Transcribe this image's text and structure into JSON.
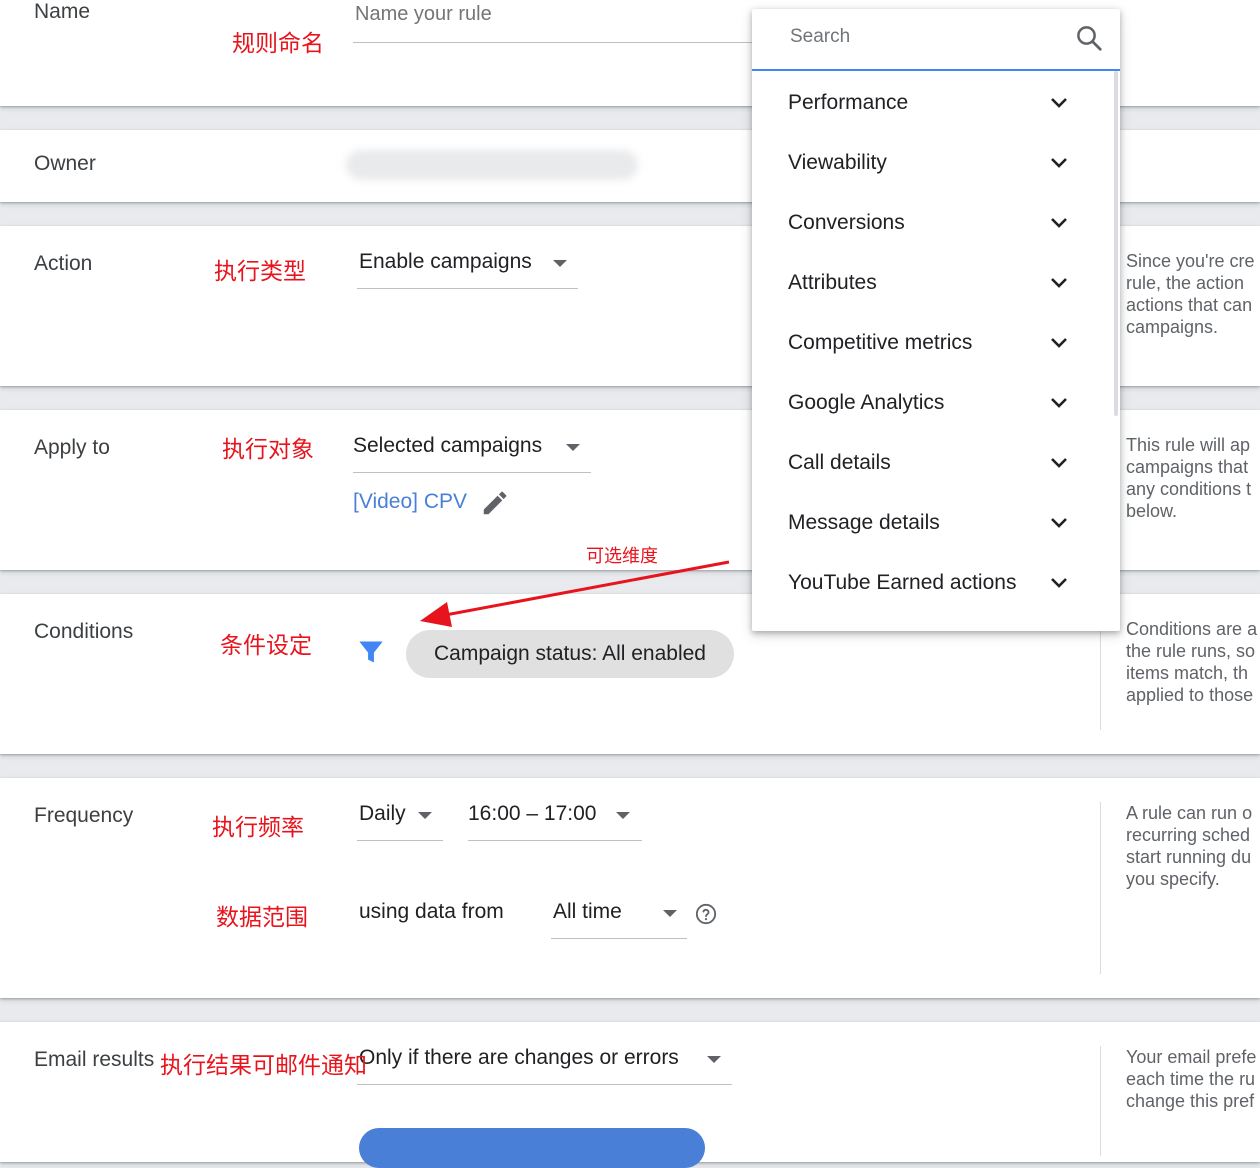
{
  "name": {
    "label": "Name",
    "annotation": "规则命名",
    "placeholder": "Name your rule"
  },
  "owner": {
    "label": "Owner"
  },
  "action": {
    "label": "Action",
    "annotation": "执行类型",
    "value": "Enable campaigns",
    "help": [
      "Since you're cre",
      "rule, the action",
      "actions that can",
      "campaigns."
    ]
  },
  "apply_to": {
    "label": "Apply to",
    "annotation": "执行对象",
    "value": "Selected campaigns",
    "campaign_link": "[Video] CPV",
    "help": [
      "This rule will ap",
      "campaigns that",
      "any conditions t",
      "below."
    ]
  },
  "arrow_annotation": "可选维度",
  "conditions": {
    "label": "Conditions",
    "annotation": "条件设定",
    "chip": "Campaign status: All enabled",
    "help": [
      "Conditions are a",
      "the rule runs, so",
      "items match, th",
      "applied to those"
    ]
  },
  "frequency": {
    "label": "Frequency",
    "annotation": "执行频率",
    "value": "Daily",
    "time": "16:00 – 17:00",
    "range_annotation": "数据范围",
    "range_label": "using data from",
    "range_value": "All time",
    "help": [
      "A rule can run o",
      "recurring sched",
      "start running du",
      "you specify."
    ]
  },
  "email": {
    "label": "Email results",
    "annotation": "执行结果可邮件通知",
    "value": "Only if there are changes or errors",
    "help": [
      "Your email prefe",
      "each time the ru",
      "change this pref"
    ]
  },
  "menu": {
    "search_placeholder": "Search",
    "items": [
      "Performance",
      "Viewability",
      "Conversions",
      "Attributes",
      "Competitive metrics",
      "Google Analytics",
      "Call details",
      "Message details",
      "YouTube Earned actions"
    ]
  },
  "colors": {
    "accent": "#4285f4",
    "annotation": "#e8141d",
    "link": "#4a7fd8"
  }
}
